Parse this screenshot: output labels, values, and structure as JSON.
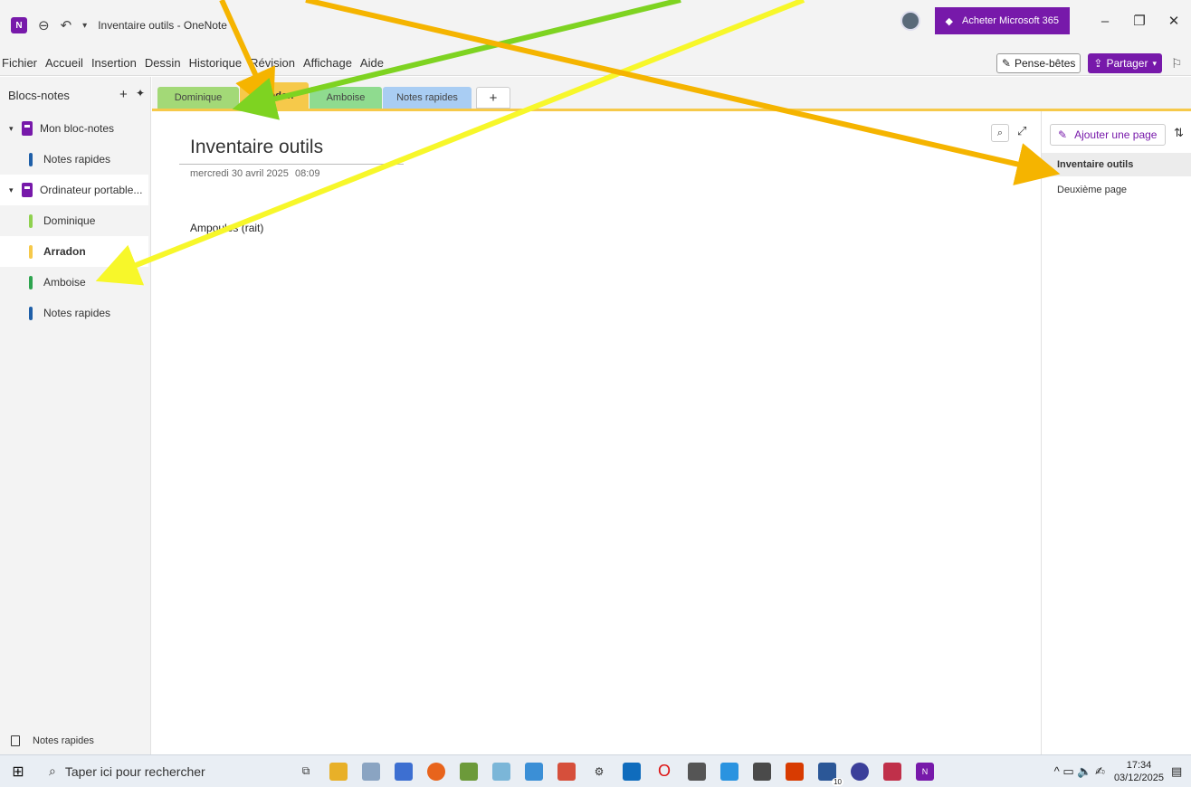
{
  "titlebar": {
    "app_icon": "N",
    "title": "Inventaire outils - OneNote",
    "buy_label": "Acheter Microsoft 365",
    "minimize": "–",
    "restore": "❐",
    "close": "✕"
  },
  "menu": {
    "items": [
      "Fichier",
      "Accueil",
      "Insertion",
      "Dessin",
      "Historique",
      "Révision",
      "Affichage",
      "Aide"
    ],
    "pense_betes": "Pense-bêtes",
    "partager": "Partager"
  },
  "sidebar": {
    "header": "Blocs-notes",
    "notebooks": [
      {
        "name": "Mon bloc-notes",
        "sections": [
          {
            "name": "Notes rapides",
            "color": "#1f5fa8"
          }
        ]
      },
      {
        "name": "Ordinateur portable...",
        "sections": [
          {
            "name": "Dominique",
            "color": "#8fd14f"
          },
          {
            "name": "Arradon",
            "color": "#f6c94a"
          },
          {
            "name": "Amboise",
            "color": "#2ea44f"
          },
          {
            "name": "Notes rapides",
            "color": "#1f5fa8"
          }
        ]
      }
    ],
    "footer": "Notes rapides"
  },
  "tabs": [
    {
      "name": "Dominique",
      "color": "#a3d977"
    },
    {
      "name": "Arradon",
      "color": "#f6c94a"
    },
    {
      "name": "Amboise",
      "color": "#8fdb8f"
    },
    {
      "name": "Notes rapides",
      "color": "#a9cdf3"
    }
  ],
  "tab_add": "+",
  "page": {
    "title": "Inventaire outils",
    "date": "mercredi 30 avril 2025",
    "time": "08:09",
    "body": "Ampoules (rait)"
  },
  "pagelist": {
    "add_label": "Ajouter une page",
    "pages": [
      "Inventaire outils",
      "Deuxième page"
    ]
  },
  "taskbar": {
    "search_placeholder": "Taper ici pour rechercher",
    "time": "17:34",
    "date": "03/12/2025",
    "badge": "10"
  },
  "colors": {
    "accent": "#7719aa",
    "arrow_yellow": "#f7f72a",
    "arrow_orange": "#f5b400",
    "arrow_green": "#7ed321"
  }
}
